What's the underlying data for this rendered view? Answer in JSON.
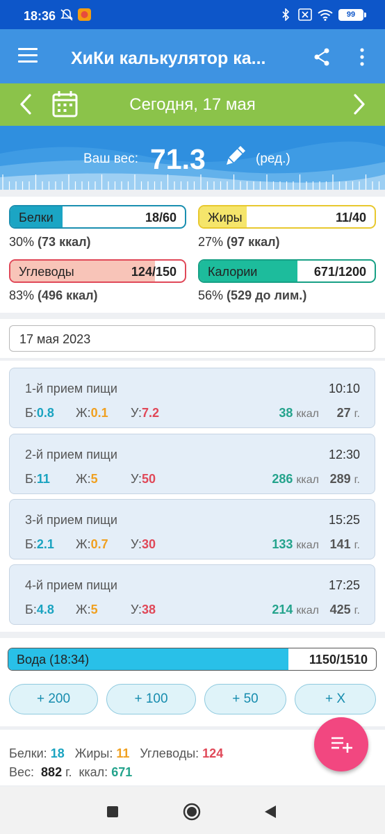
{
  "status_bar": {
    "time": "18:36",
    "battery": "99"
  },
  "app_bar": {
    "title": "ХиКи калькулятор ка..."
  },
  "date_nav": {
    "date_text": "Сегодня, 17 мая"
  },
  "weight": {
    "label": "Ваш вес:",
    "value": "71.3",
    "edit_label": "(ред.)"
  },
  "macros": {
    "protein": {
      "name": "Белки",
      "value": "18/60",
      "percent": "30%",
      "kcal": "(73 ккал)",
      "fill": 0.3,
      "color": "#1ba5c4",
      "border": "#1a8fb0"
    },
    "fat": {
      "name": "Жиры",
      "value": "11/40",
      "percent": "27%",
      "kcal": "(97 ккал)",
      "fill": 0.27,
      "color": "#f5e56b",
      "border": "#e8c82e"
    },
    "carbs": {
      "name": "Углеводы",
      "value": "124/150",
      "percent": "83%",
      "kcal": "(496 ккал)",
      "fill": 0.83,
      "color": "#f8c4b8",
      "border": "#e04858"
    },
    "calories": {
      "name": "Калории",
      "value": "671/1200",
      "percent": "56%",
      "kcal": "(529 до лим.)",
      "fill": 0.56,
      "color": "#1dbc9c",
      "border": "#17a085"
    }
  },
  "date_field": "17 мая 2023",
  "labels": {
    "p": "Б:",
    "f": "Ж:",
    "c": "У:",
    "kcal_unit": "ккал",
    "gram_unit": "г."
  },
  "meals": [
    {
      "title": "1-й прием пищи",
      "time": "10:10",
      "p": "0.8",
      "f": "0.1",
      "c": "7.2",
      "kcal": "38",
      "grams": "27"
    },
    {
      "title": "2-й прием пищи",
      "time": "12:30",
      "p": "11",
      "f": "5",
      "c": "50",
      "kcal": "286",
      "grams": "289"
    },
    {
      "title": "3-й прием пищи",
      "time": "15:25",
      "p": "2.1",
      "f": "0.7",
      "c": "30",
      "kcal": "133",
      "grams": "141"
    },
    {
      "title": "4-й прием пищи",
      "time": "17:25",
      "p": "4.8",
      "f": "5",
      "c": "38",
      "kcal": "214",
      "grams": "425"
    }
  ],
  "water": {
    "label": "Вода (18:34)",
    "value": "1150/1510",
    "fill": 0.762
  },
  "water_buttons": [
    "+ 200",
    "+ 100",
    "+ 50",
    "+ X"
  ],
  "summary": {
    "protein_label": "Белки:",
    "protein": "18",
    "fat_label": "Жиры:",
    "fat": "11",
    "carbs_label": "Углеводы:",
    "carbs": "124",
    "weight_label": "Вес:",
    "weight": "882",
    "weight_unit": "г.",
    "kcal_label": "ккал:",
    "kcal": "671"
  }
}
